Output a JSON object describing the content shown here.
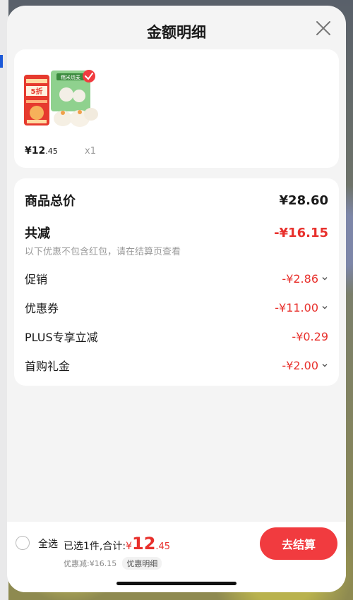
{
  "header": {
    "title": "金额明细"
  },
  "product": {
    "price_main": "¥12",
    "price_dec": ".45",
    "quantity": "x1",
    "badge_text": "5折",
    "pack_text": "糯米烧麦"
  },
  "details": {
    "total_label": "商品总价",
    "total_value": "¥28.60",
    "reduce_label": "共减",
    "reduce_value": "-¥16.15",
    "note": "以下优惠不包含红包，请在结算页查看",
    "items": [
      {
        "label": "促销",
        "value": "-¥2.86"
      },
      {
        "label": "优惠券",
        "value": "-¥11.00"
      },
      {
        "label": "PLUS专享立减",
        "value": "-¥0.29"
      },
      {
        "label": "首购礼金",
        "value": "-¥2.00"
      }
    ]
  },
  "bottom": {
    "select_all": "全选",
    "selected_text": "已选1件,合计:",
    "currency": "¥",
    "amount_main": "12",
    "amount_dec": ".45",
    "discount_text": "优惠减:¥16.15",
    "discount_tag": "优惠明细",
    "checkout_label": "去结算"
  },
  "colors": {
    "accent": "#e8302c",
    "button": "#f13b3f"
  }
}
